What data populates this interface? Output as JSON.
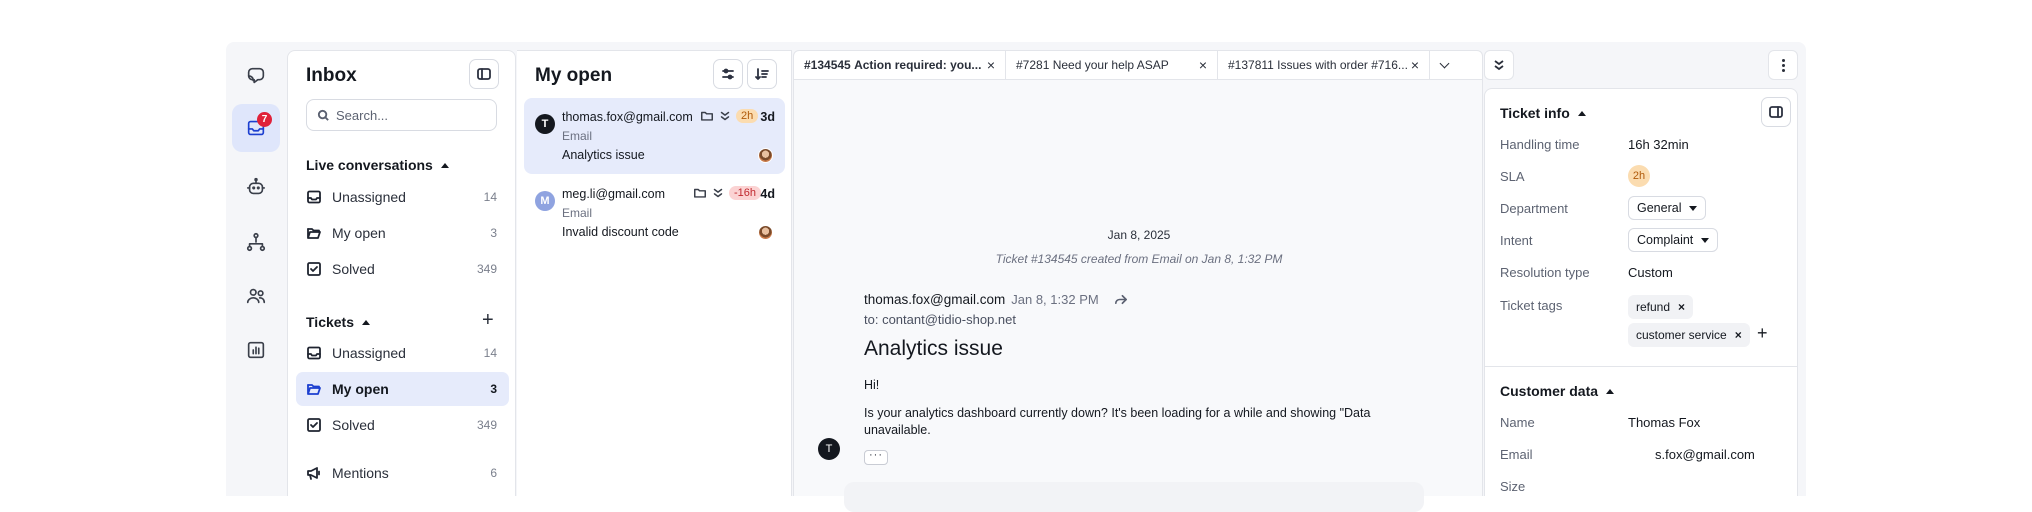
{
  "rail": {
    "badge_count": "7",
    "items": [
      "logo-icon",
      "inbox-icon",
      "bot-icon",
      "flows-icon",
      "contacts-icon",
      "analytics-icon"
    ]
  },
  "inbox": {
    "title": "Inbox",
    "search_placeholder": "Search...",
    "live_heading": "Live conversations",
    "live_items": [
      {
        "label": "Unassigned",
        "count": "14"
      },
      {
        "label": "My open",
        "count": "3"
      },
      {
        "label": "Solved",
        "count": "349"
      }
    ],
    "tickets_heading": "Tickets",
    "ticket_items": [
      {
        "label": "Unassigned",
        "count": "14"
      },
      {
        "label": "My open",
        "count": "3"
      },
      {
        "label": "Solved",
        "count": "349"
      }
    ],
    "mentions": {
      "label": "Mentions",
      "count": "6"
    }
  },
  "list": {
    "title": "My open",
    "tickets": [
      {
        "initial": "T",
        "email": "thomas.fox@gmail.com",
        "channel": "Email",
        "subject": "Analytics issue",
        "sla": "2h",
        "age": "3d",
        "avatar_color": "#14181f",
        "sla_bg": "#fbdcb0",
        "sla_fg": "#b05a0a"
      },
      {
        "initial": "M",
        "email": "meg.li@gmail.com",
        "channel": "Email",
        "subject": "Invalid discount code",
        "sla": "-16h",
        "age": "4d",
        "avatar_color": "#8fa3e0",
        "sla_bg": "#fbd3d3",
        "sla_fg": "#c0282e"
      }
    ]
  },
  "tabs": [
    {
      "id": "#134545",
      "title": "Action required: you..."
    },
    {
      "id": "#7281",
      "title": "Need your help ASAP"
    },
    {
      "id": "#137811",
      "title": "Issues with order #716..."
    }
  ],
  "conversation": {
    "date": "Jan 8, 2025",
    "created_note": "Ticket #134545 created from Email on Jan 8, 1:32 PM",
    "from": "thomas.fox@gmail.com",
    "time": "Jan 8, 1:32 PM",
    "to": "to: contant@tidio-shop.net",
    "subject": "Analytics issue",
    "greeting": "Hi!",
    "body": "Is your analytics dashboard currently down? It's been loading for a while and showing \"Data unavailable.",
    "sender_initial": "T",
    "more_label": "···"
  },
  "details": {
    "ticket_info_heading": "Ticket info",
    "rows": {
      "handling_time": {
        "label": "Handling time",
        "value": "16h 32min"
      },
      "sla": {
        "label": "SLA",
        "value": "2h"
      },
      "department": {
        "label": "Department",
        "value": "General"
      },
      "intent": {
        "label": "Intent",
        "value": "Complaint"
      },
      "resolution": {
        "label": "Resolution type",
        "value": "Custom"
      },
      "tags": {
        "label": "Ticket tags",
        "values": [
          "refund",
          "customer service"
        ]
      }
    },
    "customer_heading": "Customer data",
    "customer": {
      "name": {
        "label": "Name",
        "value": "Thomas Fox"
      },
      "email": {
        "label": "Email",
        "value": "s.fox@gmail.com"
      },
      "size": {
        "label": "Size"
      }
    }
  }
}
